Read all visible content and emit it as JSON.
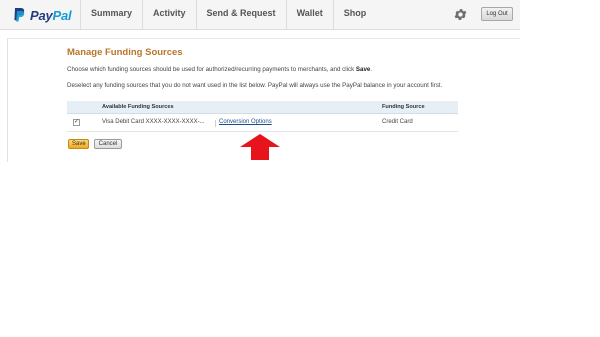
{
  "brand": {
    "name_part1": "Pay",
    "name_part2": "Pal"
  },
  "nav": {
    "items": [
      "Summary",
      "Activity",
      "Send & Request",
      "Wallet",
      "Shop"
    ]
  },
  "header": {
    "logout_label": "Log Out"
  },
  "page": {
    "title": "Manage Funding Sources",
    "desc1_text": "Choose which funding sources should be used for authorized/recurring payments to merchants, and click",
    "desc1_bold": "Save",
    "desc1_end": ".",
    "desc2": "Deselect any funding sources that you do not want used in the list below. PayPal will always use the PayPal balance in your account first."
  },
  "table": {
    "col_available": "Available Funding Sources",
    "col_source": "Funding Source",
    "rows": [
      {
        "checked": true,
        "name": "Visa Debit Card XXXX-XXXX-XXXX-...",
        "link": "Conversion Options",
        "source": "Credit Card"
      }
    ]
  },
  "buttons": {
    "save": "Save",
    "cancel": "Cancel"
  },
  "colors": {
    "title": "#b8762a",
    "link": "#1a4e8a",
    "arrow": "#e8141c",
    "brand_dark": "#253b80",
    "brand_light": "#179bd7"
  },
  "icons": {
    "logo": "paypal-logo-icon",
    "settings": "gear-icon",
    "annotation": "arrow-up-icon"
  }
}
